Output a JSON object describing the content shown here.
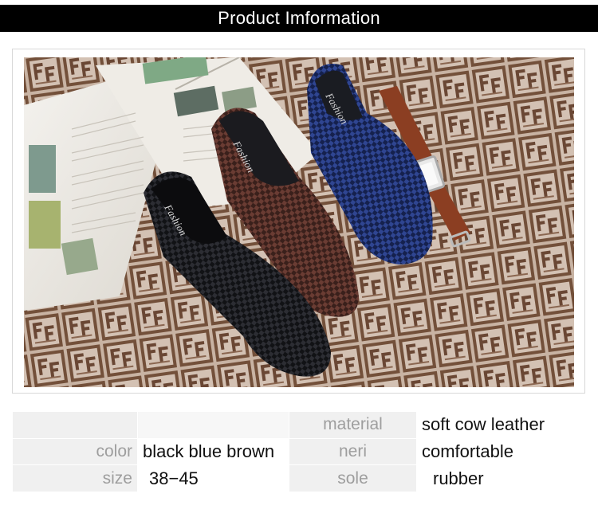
{
  "header": {
    "title": "Product Imformation"
  },
  "photo": {
    "book_icon": "open-book",
    "shoe_labels": [
      "Fashion",
      "Fashion",
      "Fashion"
    ],
    "watch_icon": "wristwatch",
    "colors": {
      "floor_light": "#cdb9a9",
      "floor_dark": "#6e4a35",
      "black_shoe": "#15161a",
      "brown_shoe": "#4a2a24",
      "blue_shoe": "#1e2e66",
      "strap": "#8b3e22"
    }
  },
  "specs": {
    "row1": {
      "label_left": "",
      "value_left": "",
      "label_right": "material",
      "value_right": "soft cow leather"
    },
    "row2": {
      "label_left": "color",
      "value_left": "black blue brown",
      "label_right": "neri",
      "value_right": "comfortable"
    },
    "row3": {
      "label_left": "size",
      "value_left": "38−45",
      "label_right": "sole",
      "value_right": "rubber"
    }
  }
}
